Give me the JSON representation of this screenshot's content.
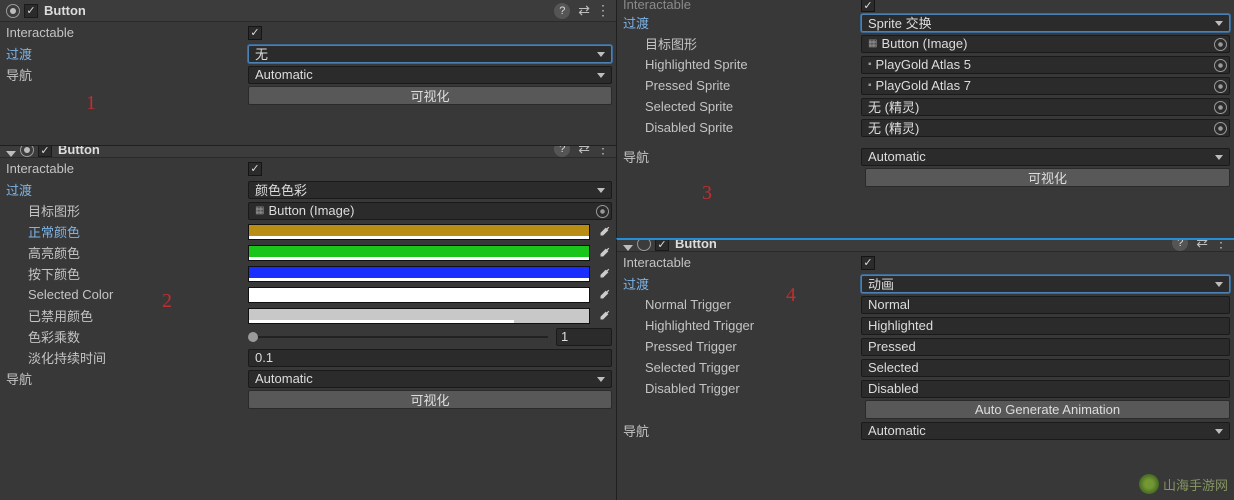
{
  "ui": {
    "checkmark": "✓"
  },
  "panel1": {
    "title": "Button",
    "interactable_label": "Interactable",
    "transition_label": "过渡",
    "transition_value": "无",
    "nav_label": "导航",
    "nav_value": "Automatic",
    "visualize_btn": "可视化"
  },
  "panel2": {
    "title": "Button",
    "interactable_label": "Interactable",
    "transition_label": "过渡",
    "transition_value": "颜色色彩",
    "target_graphic_label": "目标图形",
    "target_graphic_value": "Button (Image)",
    "normal_color_label": "正常颜色",
    "highlight_color_label": "高亮颜色",
    "pressed_color_label": "按下颜色",
    "selected_color_label": "Selected Color",
    "disabled_color_label": "已禁用颜色",
    "color_multiplier_label": "色彩乘数",
    "color_multiplier_value": "1",
    "fade_duration_label": "淡化持续时间",
    "fade_duration_value": "0.1",
    "nav_label": "导航",
    "nav_value": "Automatic",
    "visualize_btn": "可视化",
    "colors": {
      "normal": "#b98d13",
      "highlight": "#19c619",
      "pressed": "#1a2fff",
      "selected": "#ffffff",
      "disabled": "#c8c8c8"
    }
  },
  "panel3": {
    "interactable_label": "Interactable",
    "transition_label": "过渡",
    "transition_value": "Sprite 交换",
    "target_graphic_label": "目标图形",
    "target_graphic_value": "Button (Image)",
    "highlighted_sprite_label": "Highlighted Sprite",
    "highlighted_sprite_value": "PlayGold Atlas 5",
    "pressed_sprite_label": "Pressed Sprite",
    "pressed_sprite_value": "PlayGold Atlas 7",
    "selected_sprite_label": "Selected Sprite",
    "selected_sprite_value": "无 (精灵)",
    "disabled_sprite_label": "Disabled Sprite",
    "disabled_sprite_value": "无 (精灵)",
    "nav_label": "导航",
    "nav_value": "Automatic",
    "visualize_btn": "可视化"
  },
  "panel4": {
    "title": "Button",
    "interactable_label": "Interactable",
    "transition_label": "过渡",
    "transition_value": "动画",
    "normal_trigger_label": "Normal Trigger",
    "normal_trigger_value": "Normal",
    "highlighted_trigger_label": "Highlighted Trigger",
    "highlighted_trigger_value": "Highlighted",
    "pressed_trigger_label": "Pressed Trigger",
    "pressed_trigger_value": "Pressed",
    "selected_trigger_label": "Selected Trigger",
    "selected_trigger_value": "Selected",
    "disabled_trigger_label": "Disabled Trigger",
    "disabled_trigger_value": "Disabled",
    "autogen_btn": "Auto Generate Animation",
    "nav_label": "导航",
    "nav_value": "Automatic"
  },
  "annotations": {
    "a1": "1",
    "a2": "2",
    "a3": "3",
    "a4": "4"
  },
  "watermark": "山海手游网"
}
